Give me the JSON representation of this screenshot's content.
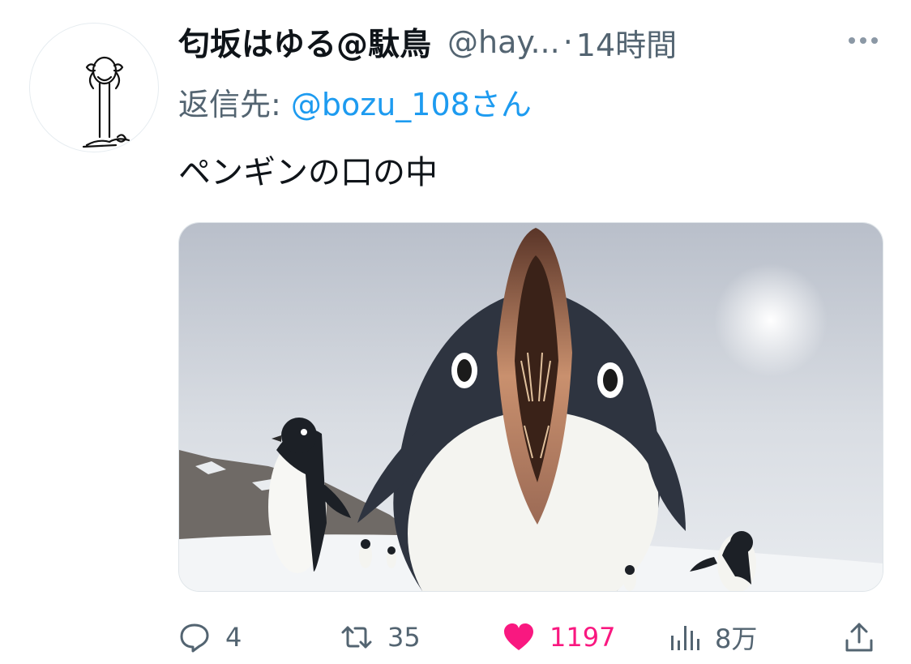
{
  "tweet": {
    "display_name": "匂坂はゆる@駄鳥",
    "handle": "@hay...",
    "separator": "·",
    "time": "14時間",
    "reply_prefix": "返信先: ",
    "reply_to": "@bozu_108さん",
    "text": "ペンギンの口の中"
  },
  "actions": {
    "replies": "4",
    "retweets": "35",
    "likes": "1197",
    "views": "8万"
  },
  "icons": {
    "more": "more-dots-icon",
    "reply": "comment-bubble-icon",
    "retweet": "retweet-icon",
    "like": "heart-icon",
    "views": "analytics-bars-icon",
    "share": "share-upload-icon"
  },
  "colors": {
    "text": "#0f1419",
    "secondary": "#536471",
    "link": "#1d9bf0",
    "like": "#f91880"
  }
}
